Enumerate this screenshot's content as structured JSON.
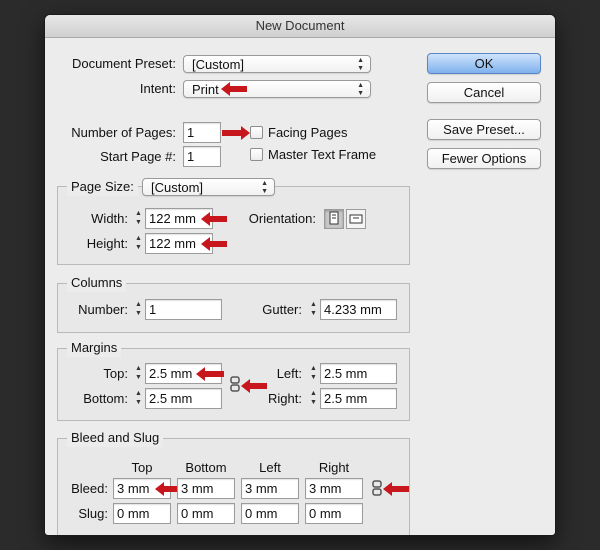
{
  "window": {
    "title": "New Document"
  },
  "document_preset": {
    "label": "Document Preset:",
    "value": "[Custom]"
  },
  "intent": {
    "label": "Intent:",
    "value": "Print"
  },
  "number_of_pages": {
    "label": "Number of Pages:",
    "value": "1"
  },
  "start_page": {
    "label": "Start Page #:",
    "value": "1"
  },
  "facing_pages": {
    "label": "Facing Pages",
    "checked": false
  },
  "master_text_frame": {
    "label": "Master Text Frame",
    "checked": false
  },
  "buttons": {
    "ok": "OK",
    "cancel": "Cancel",
    "save_preset": "Save Preset...",
    "fewer_options": "Fewer Options"
  },
  "page_size": {
    "label": "Page Size:",
    "value": "[Custom]",
    "width_label": "Width:",
    "width": "122 mm",
    "height_label": "Height:",
    "height": "122 mm",
    "orientation_label": "Orientation:"
  },
  "columns": {
    "title": "Columns",
    "number_label": "Number:",
    "number": "1",
    "gutter_label": "Gutter:",
    "gutter": "4.233 mm"
  },
  "margins": {
    "title": "Margins",
    "top_label": "Top:",
    "top": "2.5 mm",
    "bottom_label": "Bottom:",
    "bottom": "2.5 mm",
    "left_label": "Left:",
    "left": "2.5 mm",
    "right_label": "Right:",
    "right": "2.5 mm"
  },
  "bleed_slug": {
    "title": "Bleed and Slug",
    "headers": [
      "Top",
      "Bottom",
      "Left",
      "Right"
    ],
    "bleed_label": "Bleed:",
    "bleed": [
      "3 mm",
      "3 mm",
      "3 mm",
      "3 mm"
    ],
    "slug_label": "Slug:",
    "slug": [
      "0 mm",
      "0 mm",
      "0 mm",
      "0 mm"
    ]
  },
  "colors": {
    "annotation_arrow": "#c8161d",
    "ok_button": "#7fb1ee"
  }
}
